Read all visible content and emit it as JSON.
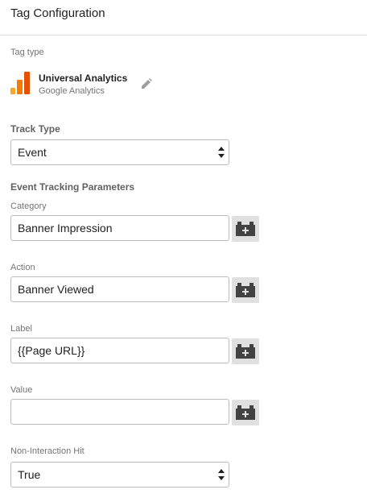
{
  "header": {
    "title": "Tag Configuration"
  },
  "tag_type": {
    "section_label": "Tag type",
    "name": "Universal Analytics",
    "vendor": "Google Analytics",
    "logo_icon": "google-analytics-logo",
    "edit_icon": "pencil-icon"
  },
  "track_type": {
    "label": "Track Type",
    "selected": "Event"
  },
  "event_params": {
    "heading": "Event Tracking Parameters",
    "category": {
      "label": "Category",
      "value": "Banner Impression"
    },
    "action": {
      "label": "Action",
      "value": "Banner Viewed"
    },
    "label": {
      "label": "Label",
      "value": "{{Page URL}}"
    },
    "value": {
      "label": "Value",
      "value": ""
    },
    "variable_icon": "add-variable-brick-icon"
  },
  "non_interaction": {
    "label": "Non-Interaction Hit",
    "selected": "True"
  },
  "colors": {
    "ga_yellow": "#f9a825",
    "ga_orange": "#f57c00",
    "ga_dark_orange": "#e65100",
    "variable_button_bg": "#e0e0e0"
  }
}
